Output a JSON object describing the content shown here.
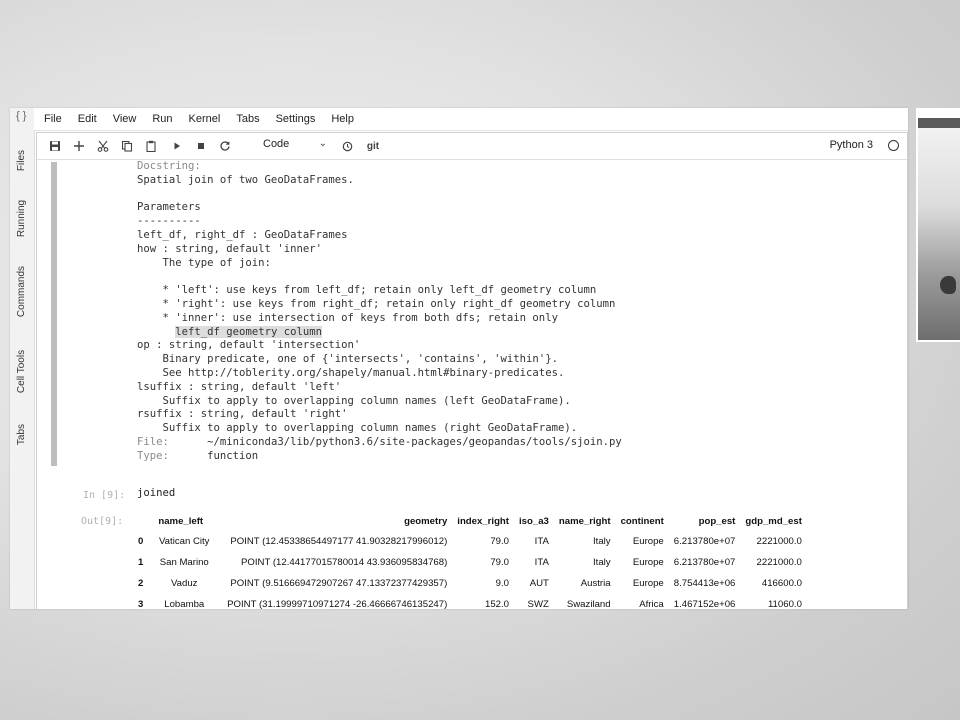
{
  "menu": [
    "File",
    "Edit",
    "View",
    "Run",
    "Kernel",
    "Tabs",
    "Settings",
    "Help"
  ],
  "left_tabs": [
    "Files",
    "Running",
    "Commands",
    "Cell Tools",
    "Tabs"
  ],
  "left_strip_symbol": "{ }",
  "toolbar": {
    "icons": [
      "save-icon",
      "add-cell-icon",
      "cut-icon",
      "copy-icon",
      "paste-icon",
      "run-icon",
      "stop-icon",
      "restart-icon"
    ],
    "cell_type": "Code",
    "clock_icon": "clock-icon",
    "git_label": "git",
    "kernel_name": "Python 3"
  },
  "docstring_lines": [
    {
      "text": "Docstring:",
      "dim": true
    },
    {
      "text": "Spatial join of two GeoDataFrames."
    },
    {
      "text": ""
    },
    {
      "text": "Parameters"
    },
    {
      "text": "----------"
    },
    {
      "text": "left_df, right_df : GeoDataFrames"
    },
    {
      "text": "how : string, default 'inner'"
    },
    {
      "text": "    The type of join:"
    },
    {
      "text": ""
    },
    {
      "text": "    * 'left': use keys from left_df; retain only left_df geometry column"
    },
    {
      "text": "    * 'right': use keys from right_df; retain only right_df geometry column"
    },
    {
      "text": "    * 'inner': use intersection of keys from both dfs; retain only"
    },
    {
      "text": "      left_df geometry column",
      "highlight": true
    },
    {
      "text": "op : string, default 'intersection'"
    },
    {
      "text": "    Binary predicate, one of {'intersects', 'contains', 'within'}."
    },
    {
      "text": "    See http://toblerity.org/shapely/manual.html#binary-predicates."
    },
    {
      "text": "lsuffix : string, default 'left'"
    },
    {
      "text": "    Suffix to apply to overlapping column names (left GeoDataFrame)."
    },
    {
      "text": "rsuffix : string, default 'right'"
    },
    {
      "text": "    Suffix to apply to overlapping column names (right GeoDataFrame)."
    },
    {
      "label": "File:",
      "text": "      ~/miniconda3/lib/python3.6/site-packages/geopandas/tools/sjoin.py"
    },
    {
      "label": "Type:",
      "text": "      function"
    }
  ],
  "input_cell": {
    "prompt": "In [9]:",
    "code": "joined"
  },
  "output_prompt": "Out[9]:",
  "dataframe": {
    "columns": [
      "name_left",
      "geometry",
      "index_right",
      "iso_a3",
      "name_right",
      "continent",
      "pop_est",
      "gdp_md_est"
    ],
    "rows": [
      {
        "index": "0",
        "cells": [
          "Vatican City",
          "POINT (12.45338654497177 41.90328217996012)",
          "79.0",
          "ITA",
          "Italy",
          "Europe",
          "6.213780e+07",
          "2221000.0"
        ]
      },
      {
        "index": "1",
        "cells": [
          "San Marino",
          "POINT (12.44177015780014 43.936095834768)",
          "79.0",
          "ITA",
          "Italy",
          "Europe",
          "6.213780e+07",
          "2221000.0"
        ]
      },
      {
        "index": "2",
        "cells": [
          "Vaduz",
          "POINT (9.516669472907267 47.13372377429357)",
          "9.0",
          "AUT",
          "Austria",
          "Europe",
          "8.754413e+06",
          "416600.0"
        ]
      },
      {
        "index": "3",
        "cells": [
          "Lobamba",
          "POINT (31.19999710971274 -26.46666746135247)",
          "152.0",
          "SWZ",
          "Swaziland",
          "Africa",
          "1.467152e+06",
          "11060.0"
        ]
      }
    ]
  }
}
